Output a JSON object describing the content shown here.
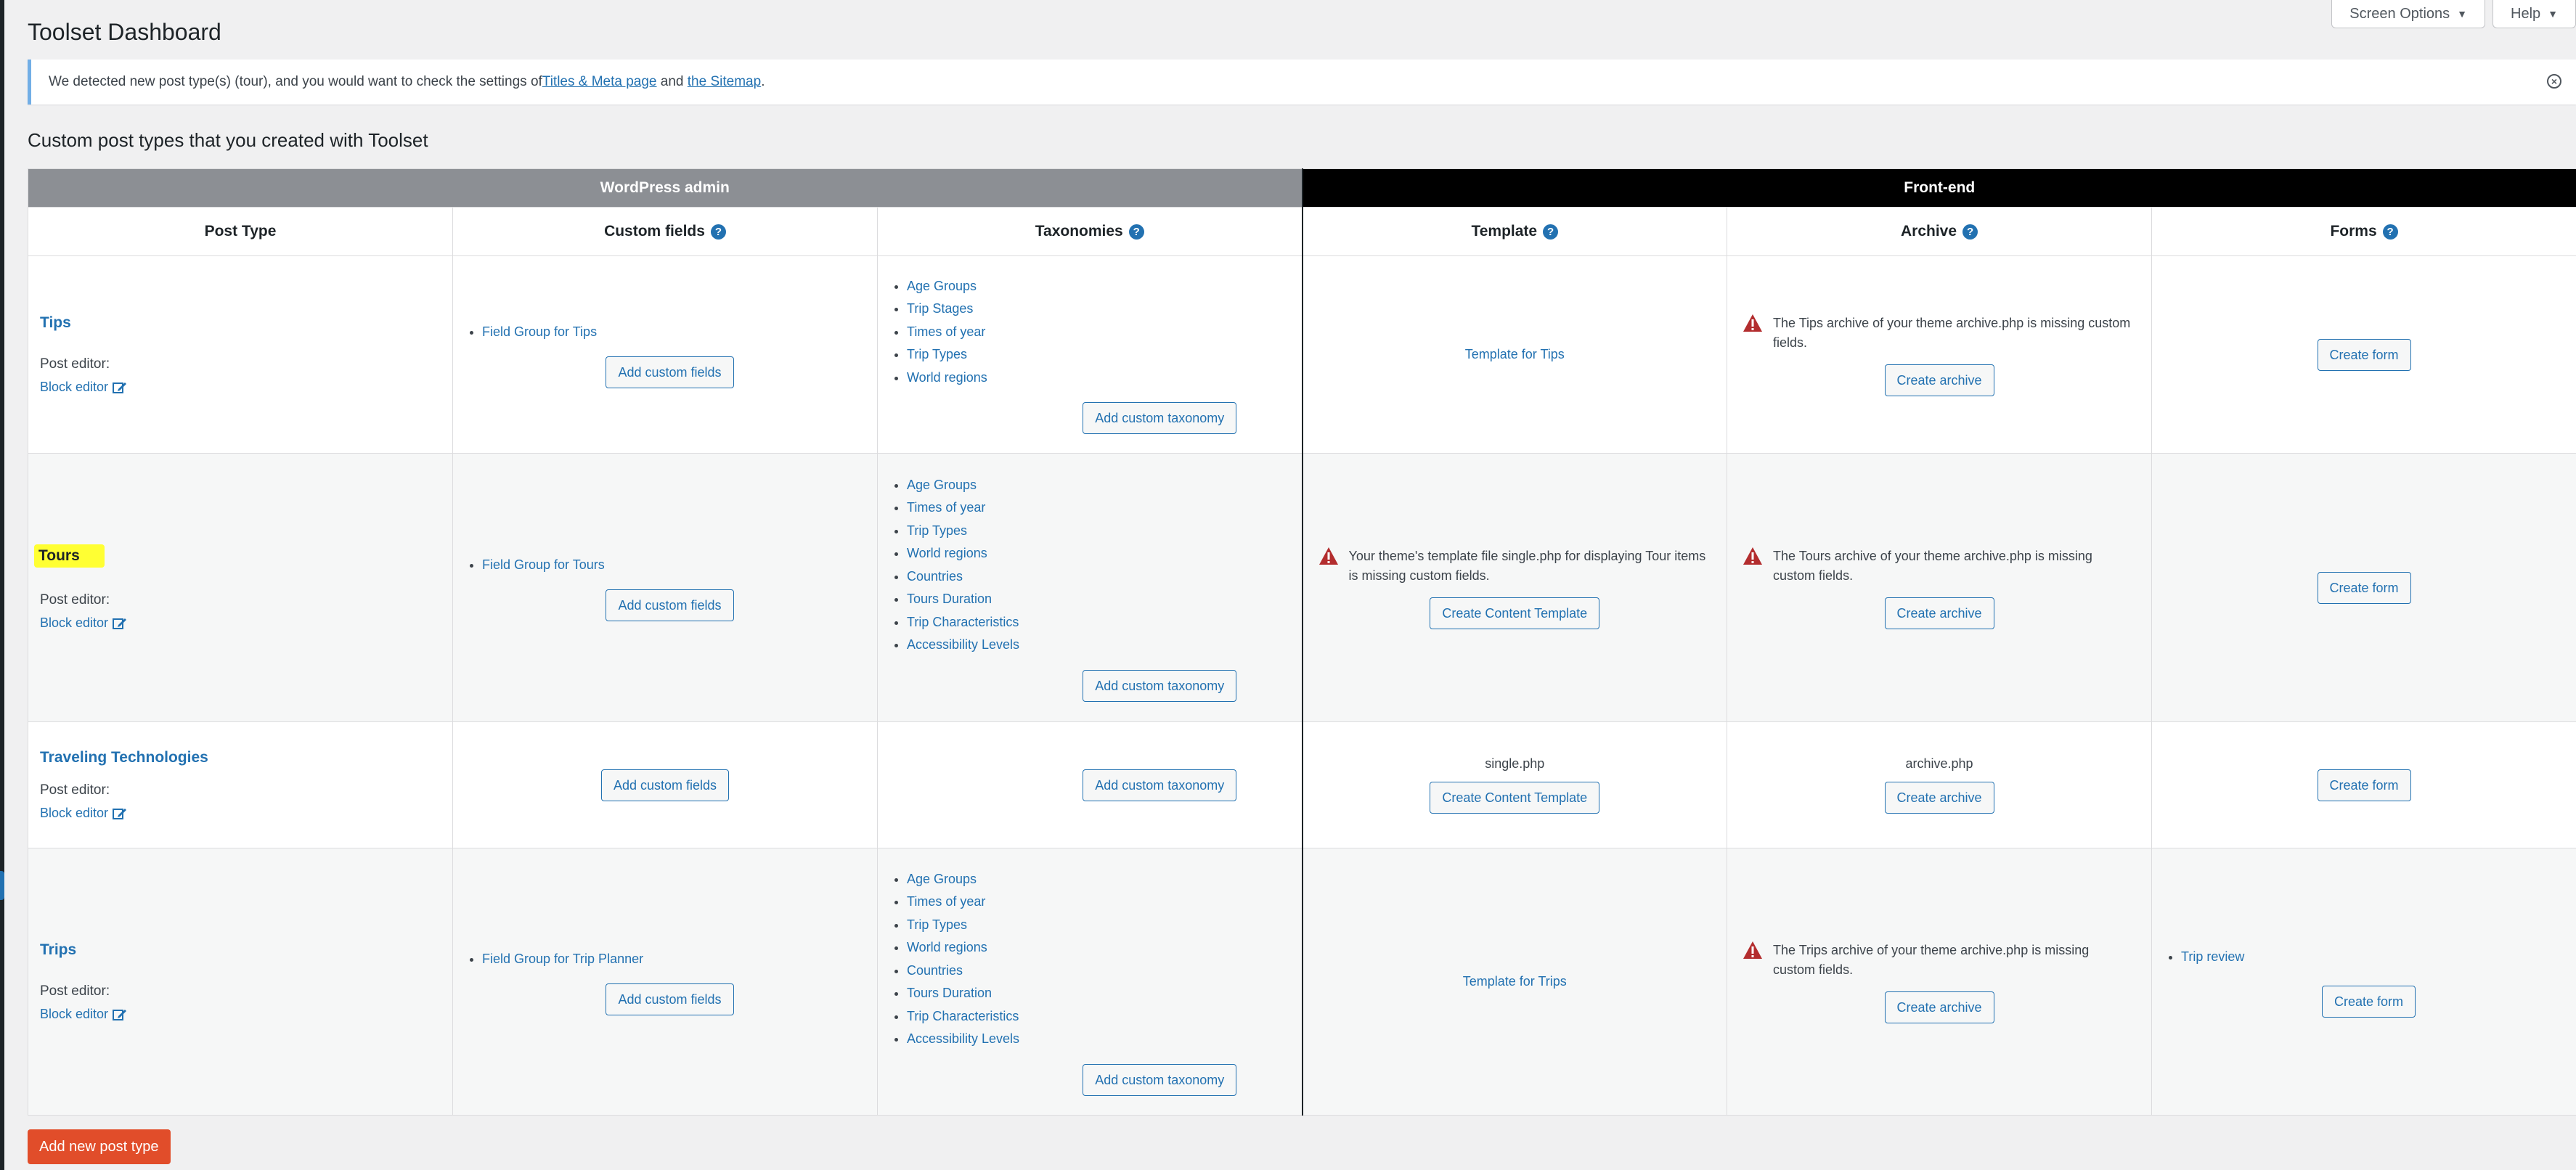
{
  "header": {
    "title": "Toolset Dashboard",
    "screen_options_label": "Screen Options",
    "help_label": "Help"
  },
  "notice": {
    "text_before": "We detected new post type(s) (tour), and you would want to check the settings of ",
    "link1": "Titles & Meta page",
    "text_middle": " and ",
    "link2": "the Sitemap",
    "text_after": "."
  },
  "section_title": "Custom post types that you created with Toolset",
  "table": {
    "groups": {
      "wp_admin": "WordPress admin",
      "front_end": "Front-end"
    },
    "columns": {
      "post_type": "Post Type",
      "custom_fields": "Custom fields",
      "taxonomies": "Taxonomies",
      "template": "Template",
      "archive": "Archive",
      "forms": "Forms"
    },
    "labels": {
      "post_editor": "Post editor:",
      "block_editor": "Block editor",
      "add_custom_fields": "Add custom fields",
      "add_custom_taxonomy": "Add custom taxonomy",
      "create_archive": "Create archive",
      "create_form": "Create form",
      "create_content_template": "Create Content Template"
    },
    "rows": [
      {
        "name": "Tips",
        "field_groups": [
          "Field Group for Tips"
        ],
        "taxonomies": [
          "Age Groups",
          "Trip Stages",
          "Times of year",
          "Trip Types",
          "World regions"
        ],
        "template_link": "Template for Tips",
        "archive_warning": "The Tips archive of your theme archive.php is missing custom fields."
      },
      {
        "name": "Tours",
        "field_groups": [
          "Field Group for Tours"
        ],
        "taxonomies": [
          "Age Groups",
          "Times of year",
          "Trip Types",
          "World regions",
          "Countries",
          "Tours Duration",
          "Trip Characteristics",
          "Accessibility Levels"
        ],
        "template_warning": "Your theme's template file single.php for displaying Tour items is missing custom fields.",
        "archive_warning": "The Tours archive of your theme archive.php is missing custom fields."
      },
      {
        "name": "Traveling Technologies",
        "template_file": "single.php",
        "archive_file": "archive.php"
      },
      {
        "name": "Trips",
        "field_groups": [
          "Field Group for Trip Planner"
        ],
        "taxonomies": [
          "Age Groups",
          "Times of year",
          "Trip Types",
          "World regions",
          "Countries",
          "Tours Duration",
          "Trip Characteristics",
          "Accessibility Levels"
        ],
        "template_link": "Template for Trips",
        "archive_warning": "The Trips archive of your theme archive.php is missing custom fields.",
        "forms": [
          "Trip review"
        ]
      }
    ]
  },
  "footer": {
    "add_new_label": "Add new post type"
  }
}
